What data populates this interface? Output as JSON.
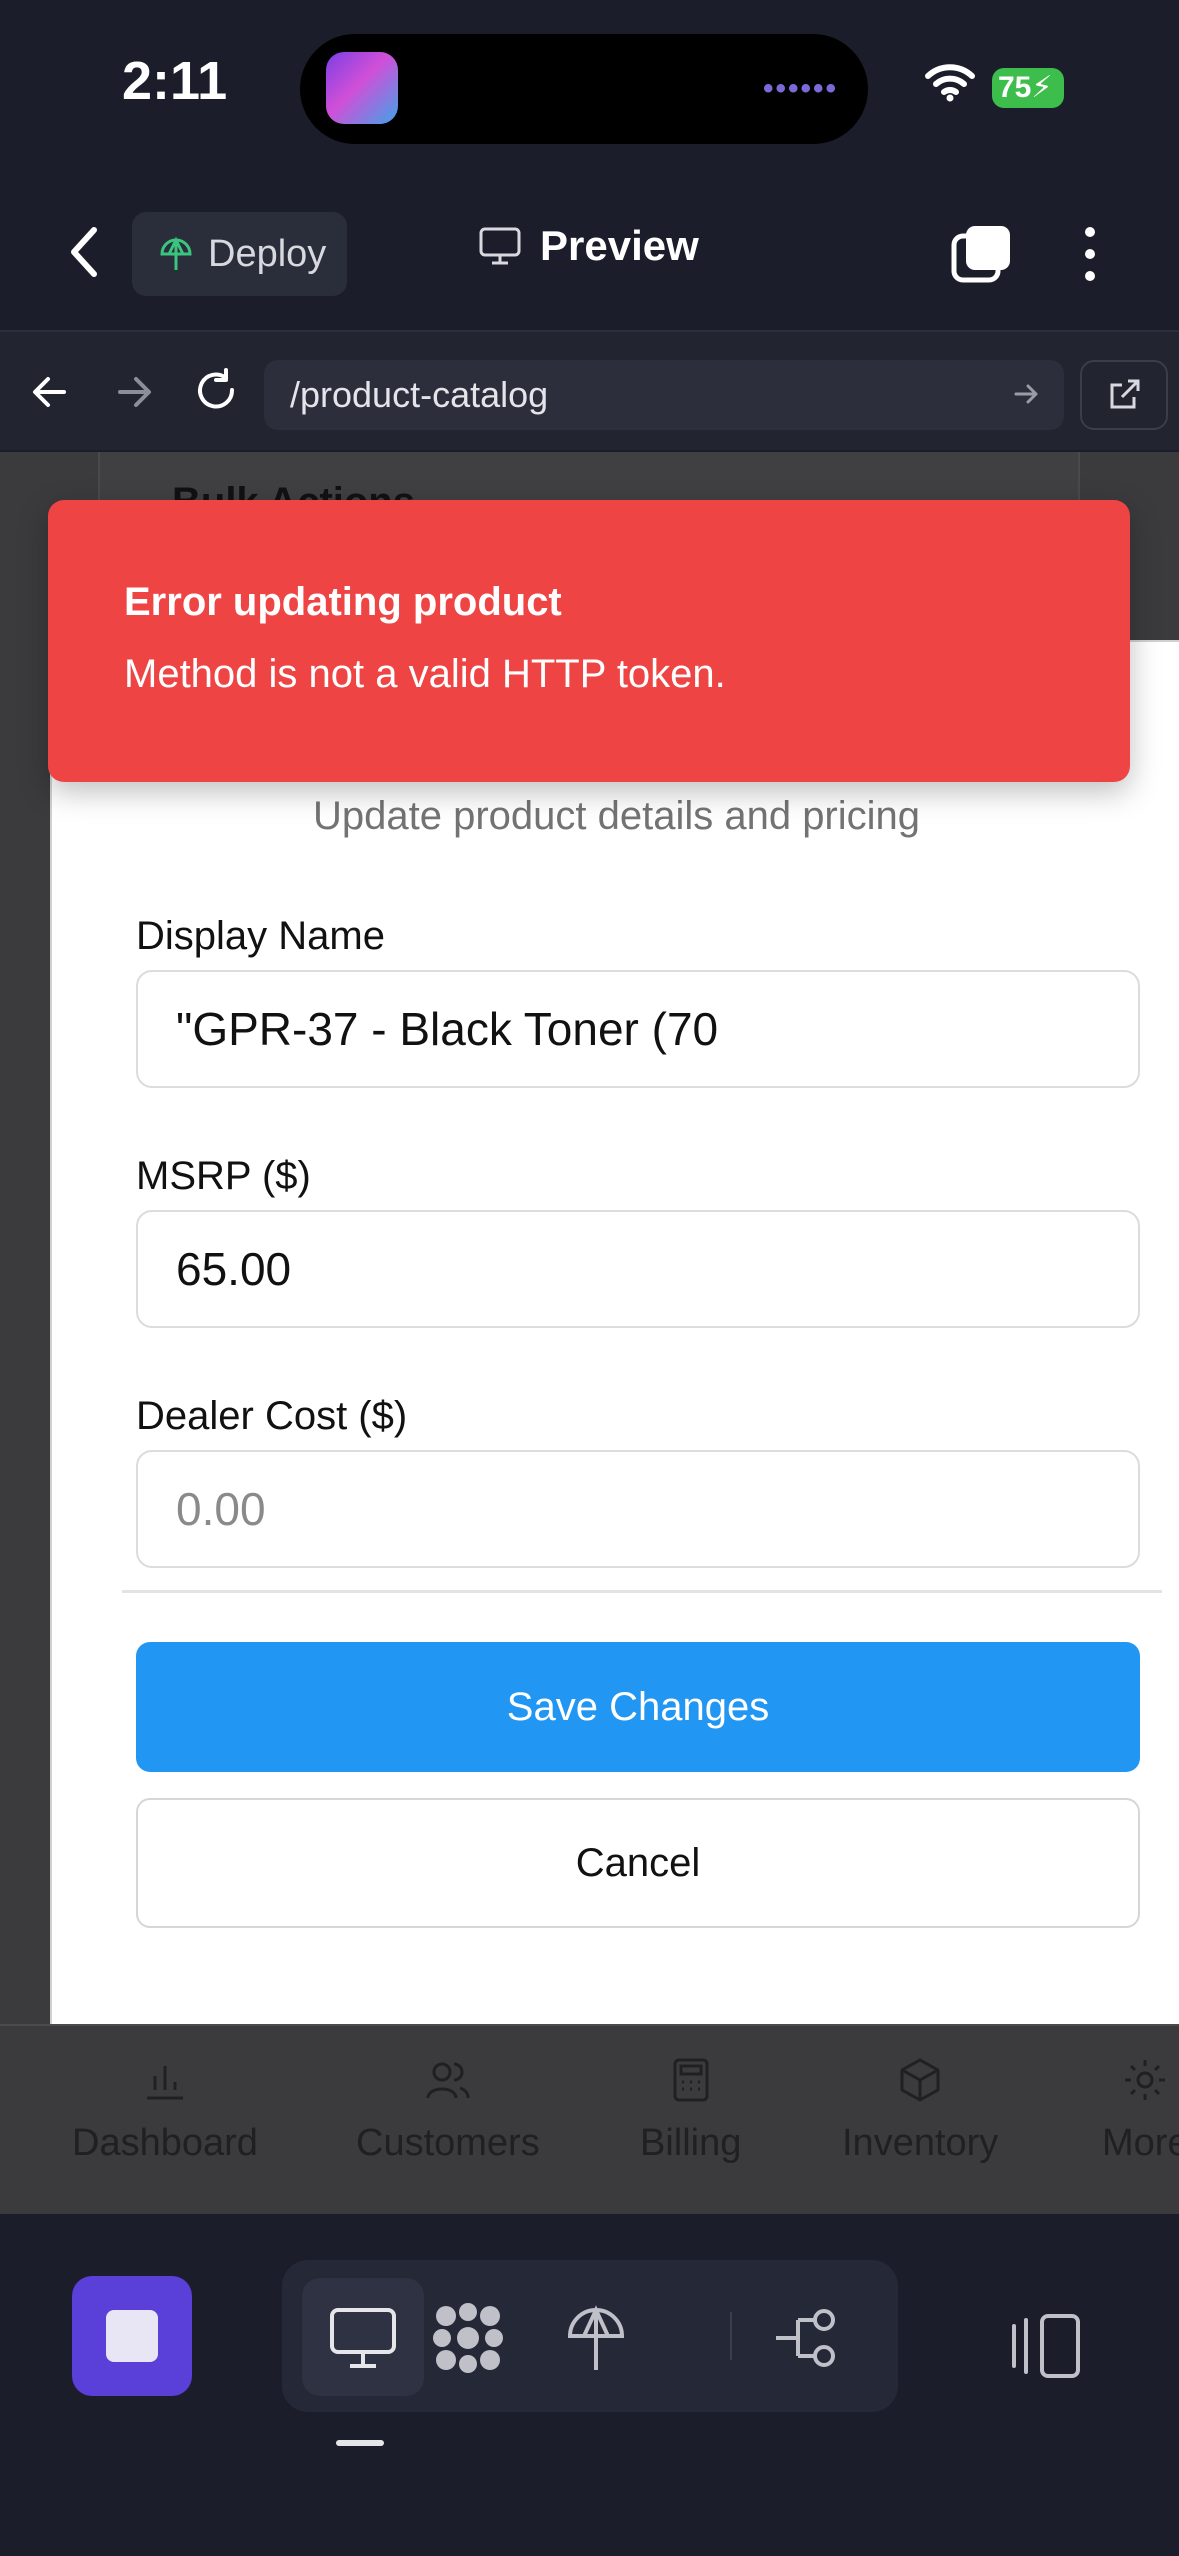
{
  "status_bar": {
    "time": "2:11",
    "battery": "75"
  },
  "header": {
    "deploy_label": "Deploy",
    "preview_label": "Preview"
  },
  "browser": {
    "url": "/product-catalog"
  },
  "background_page": {
    "section_title": "Bulk Actions"
  },
  "toast": {
    "title": "Error updating product",
    "message": "Method is not a valid HTTP token.",
    "color": "#ef4444"
  },
  "modal": {
    "subtitle": "Update product details and pricing",
    "fields": [
      {
        "label": "Display Name",
        "value": "\"GPR-37 - Black Toner (70",
        "placeholder": ""
      },
      {
        "label": "MSRP ($)",
        "value": "65.00",
        "placeholder": ""
      },
      {
        "label": "Dealer Cost ($)",
        "value": "",
        "placeholder": "0.00"
      }
    ],
    "save_label": "Save Changes",
    "cancel_label": "Cancel",
    "save_color": "#2196f3"
  },
  "app_nav": [
    {
      "label": "Dashboard",
      "icon": "bar-chart-icon"
    },
    {
      "label": "Customers",
      "icon": "users-icon"
    },
    {
      "label": "Billing",
      "icon": "calculator-icon"
    },
    {
      "label": "Inventory",
      "icon": "box-icon"
    },
    {
      "label": "More",
      "icon": "gear-icon"
    }
  ],
  "dock": {
    "stop_color": "#5b3fd9",
    "tools": [
      "monitor-icon",
      "dots-grid-icon",
      "deploy-icon",
      "workflow-icon"
    ],
    "panel_icon": "side-panel-icon"
  }
}
